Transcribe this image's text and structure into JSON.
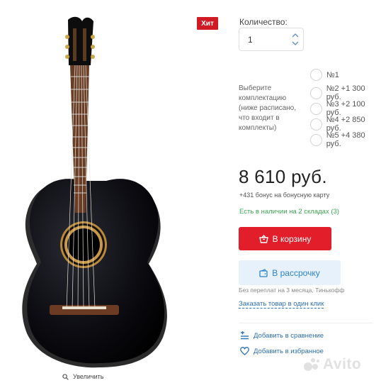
{
  "badge": "Хит",
  "zoom_label": "Увеличить",
  "quantity": {
    "label": "Количество:",
    "value": "1"
  },
  "options": {
    "label": "Выберите комплектацию (ниже расписано, что входит в комплекты)",
    "items": [
      "№1",
      "№2 +1 300 руб.",
      "№3 +2 100 руб.",
      "№4 +2 850 руб.",
      "№5 +4 380 руб."
    ]
  },
  "price": "8 610 руб.",
  "bonus": "+431 бонус на бонусную карту",
  "stock": "Есть в наличии на 2 складах (3)",
  "buttons": {
    "cart": "В корзину",
    "credit": "В рассрочку"
  },
  "credit_note": "Без переплат на 3 месяца, Тинькофф",
  "one_click": "Заказать товар в один клик",
  "links": {
    "compare": "Добавить в сравнение",
    "favorite": "Добавить в избранное"
  },
  "watermark": "Avito",
  "colors": {
    "accent_red": "#e21e2b",
    "link_blue": "#2d6fb2",
    "stock_green": "#3ea454"
  }
}
